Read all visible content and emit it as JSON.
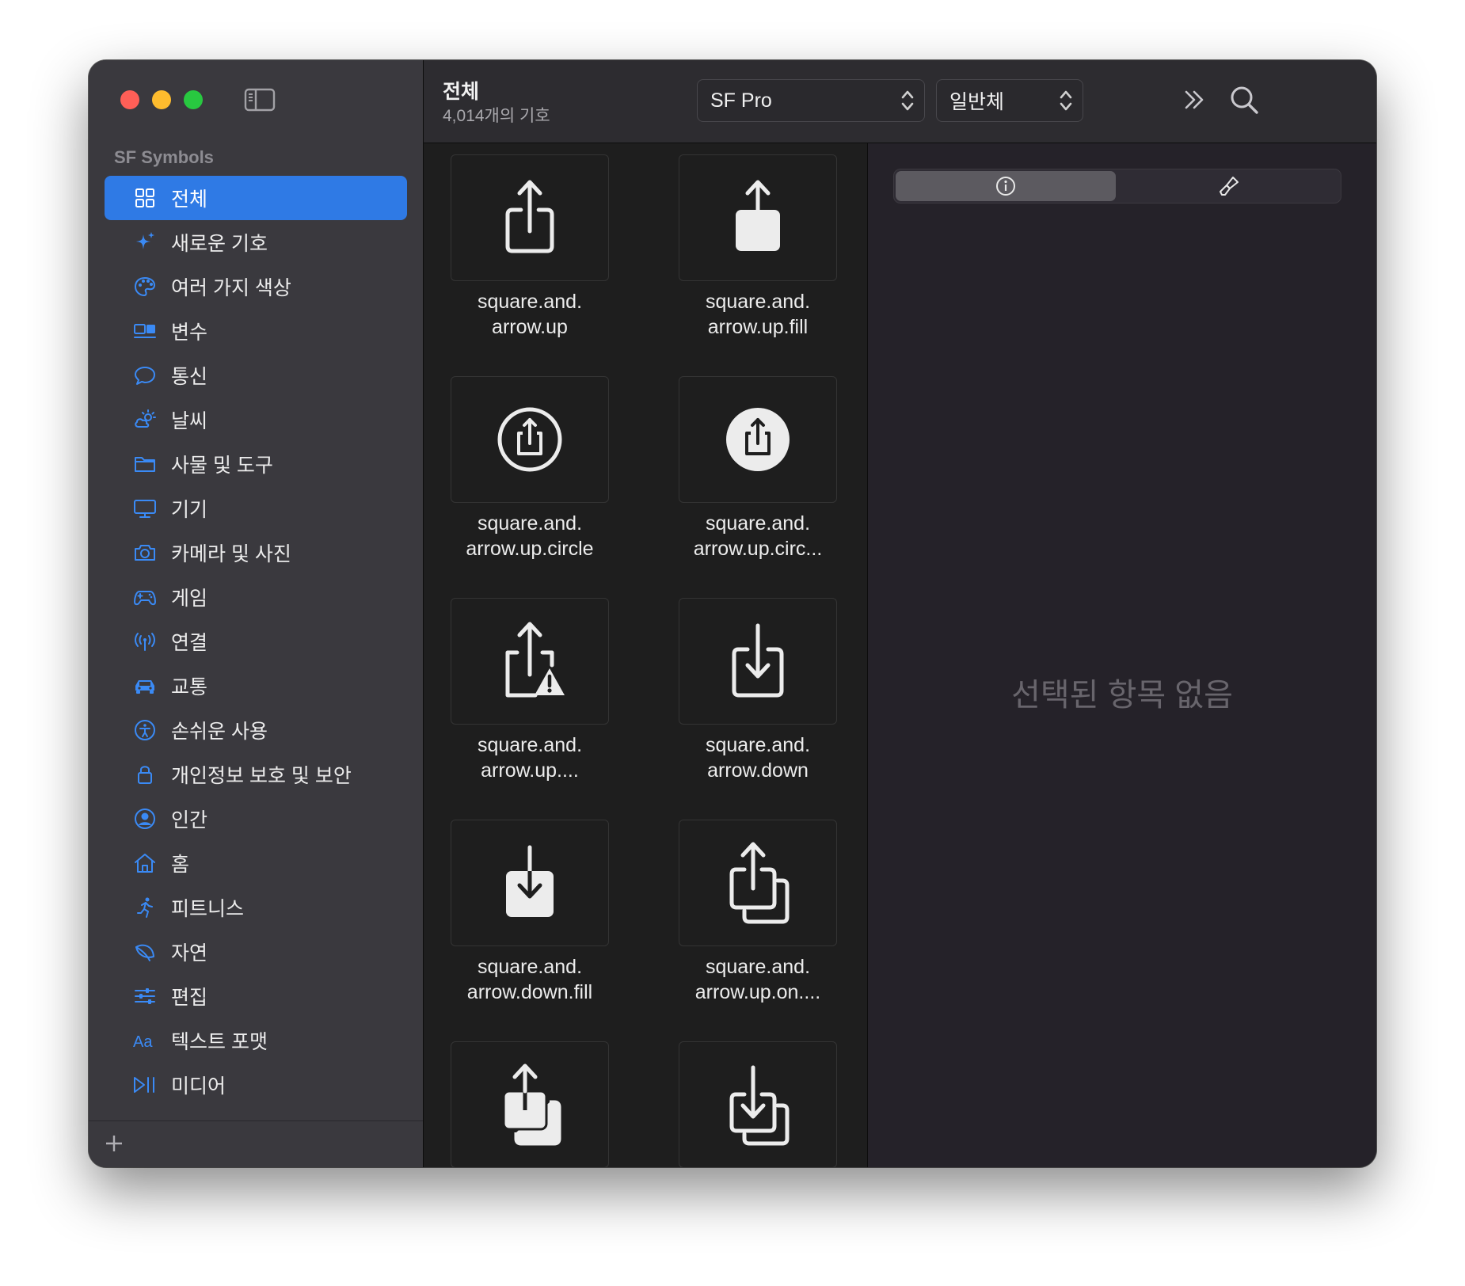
{
  "sidebar": {
    "section_title": "SF Symbols",
    "items": [
      {
        "label": "전체",
        "icon": "grid-icon",
        "selected": true
      },
      {
        "label": "새로운 기호",
        "icon": "sparkles-icon"
      },
      {
        "label": "여러 가지 색상",
        "icon": "paintpalette-icon"
      },
      {
        "label": "변수",
        "icon": "variable-icon"
      },
      {
        "label": "통신",
        "icon": "message-bubble-icon"
      },
      {
        "label": "날씨",
        "icon": "cloud-sun-icon"
      },
      {
        "label": "사물 및 도구",
        "icon": "folder-icon"
      },
      {
        "label": "기기",
        "icon": "display-icon"
      },
      {
        "label": "카메라 및 사진",
        "icon": "camera-icon"
      },
      {
        "label": "게임",
        "icon": "gamecontroller-icon"
      },
      {
        "label": "연결",
        "icon": "antenna-icon"
      },
      {
        "label": "교통",
        "icon": "car-icon"
      },
      {
        "label": "손쉬운 사용",
        "icon": "accessibility-icon"
      },
      {
        "label": "개인정보 보호 및 보안",
        "icon": "lock-icon"
      },
      {
        "label": "인간",
        "icon": "person-circle-icon"
      },
      {
        "label": "홈",
        "icon": "house-icon"
      },
      {
        "label": "피트니스",
        "icon": "figure-run-icon"
      },
      {
        "label": "자연",
        "icon": "leaf-icon"
      },
      {
        "label": "편집",
        "icon": "slider-icon"
      },
      {
        "label": "텍스트 포맷",
        "icon": "textformat-icon"
      },
      {
        "label": "미디어",
        "icon": "playpause-icon"
      }
    ]
  },
  "toolbar": {
    "title": "전체",
    "subtitle": "4,014개의 기호",
    "font_popup": "SF Pro",
    "weight_popup": "일반체"
  },
  "grid": {
    "symbols": [
      {
        "name": "square.and.\narrow.up",
        "icon": "square-and-arrow-up-icon"
      },
      {
        "name": "square.and.\narrow.up.fill",
        "icon": "square-and-arrow-up-fill-icon"
      },
      {
        "name": "square.and.\narrow.up.circle",
        "icon": "square-and-arrow-up-circle-icon"
      },
      {
        "name": "square.and.\narrow.up.circ...",
        "icon": "square-and-arrow-up-circle-fill-icon"
      },
      {
        "name": "square.and.\narrow.up....",
        "icon": "square-and-arrow-up-trianglebadge-icon"
      },
      {
        "name": "square.and.\narrow.down",
        "icon": "square-and-arrow-down-icon"
      },
      {
        "name": "square.and.\narrow.down.fill",
        "icon": "square-and-arrow-down-fill-icon"
      },
      {
        "name": "square.and.\narrow.up.on....",
        "icon": "square-and-arrow-up-on-square-icon"
      },
      {
        "name": "",
        "icon": "square-and-arrow-up-on-square-fill-icon"
      },
      {
        "name": "",
        "icon": "square-and-arrow-down-on-square-icon"
      }
    ]
  },
  "inspector": {
    "empty_message": "선택된 항목 없음"
  },
  "colors": {
    "accent": "#2f7ae5",
    "sidebar_icon": "#3a8af5"
  }
}
